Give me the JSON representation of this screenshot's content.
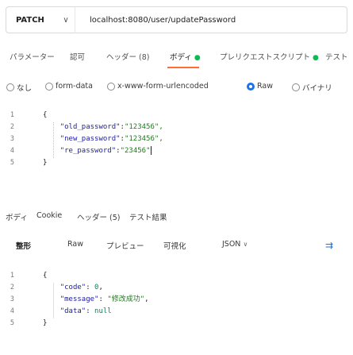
{
  "request": {
    "method": "PATCH",
    "url": "localhost:8080/user/updatePassword"
  },
  "request_tabs": [
    {
      "label": "パラメーター",
      "active": false,
      "dot": false
    },
    {
      "label": "認可",
      "active": false,
      "dot": false
    },
    {
      "label": "ヘッダー (8)",
      "active": false,
      "dot": false
    },
    {
      "label": "ボディ",
      "active": true,
      "dot": true
    },
    {
      "label": "プレリクエストスクリプト",
      "active": false,
      "dot": true
    },
    {
      "label": "テスト",
      "active": false,
      "dot": false
    }
  ],
  "body_types": [
    {
      "label": "なし",
      "checked": false
    },
    {
      "label": "form-data",
      "checked": false
    },
    {
      "label": "x-www-form-urlencoded",
      "checked": false
    },
    {
      "label": "Raw",
      "checked": true
    },
    {
      "label": "バイナリ",
      "checked": false
    }
  ],
  "request_body": {
    "line_numbers": [
      "1",
      "2",
      "3",
      "4",
      "5"
    ],
    "lines": [
      {
        "key": "",
        "value": "{"
      },
      {
        "key": "\"old_password\"",
        "value": "\"123456\","
      },
      {
        "key": "\"new_password\"",
        "value": "\"123456\","
      },
      {
        "key": "\"re_password\"",
        "value": "\"23456\""
      },
      {
        "key": "",
        "value": "}"
      }
    ]
  },
  "response_tabs": [
    "ボディ",
    "Cookie",
    "ヘッダー (5)",
    "テスト結果"
  ],
  "response_toolbar": {
    "views": [
      "整形",
      "Raw",
      "プレビュー",
      "可視化"
    ],
    "format": "JSON"
  },
  "response_body": {
    "line_numbers": [
      "1",
      "2",
      "3",
      "4",
      "5"
    ],
    "open": "{",
    "close": "}",
    "code_key": "\"code\"",
    "code_val": "0",
    "message_key": "\"message\"",
    "message_val": "\"修改成功\"",
    "data_key": "\"data\"",
    "data_val": "null"
  },
  "colors": {
    "accent": "#ff6c37",
    "radio": "#1a73e8",
    "dot": "#0cbb52"
  }
}
